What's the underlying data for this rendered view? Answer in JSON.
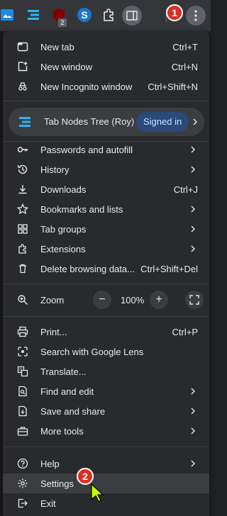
{
  "markers": {
    "one": "1",
    "two": "2"
  },
  "extension_badge": "2",
  "menu": {
    "group1": [
      {
        "icon": "new-tab-icon",
        "label": "New tab",
        "shortcut": "Ctrl+T"
      },
      {
        "icon": "new-window-icon",
        "label": "New window",
        "shortcut": "Ctrl+N"
      },
      {
        "icon": "incognito-icon",
        "label": "New Incognito window",
        "shortcut": "Ctrl+Shift+N"
      }
    ],
    "profile": {
      "label": "Tab Nodes Tree (Roy)",
      "status": "Signed in"
    },
    "group2": [
      {
        "icon": "key-icon",
        "label": "Passwords and autofill",
        "shortcut": ""
      },
      {
        "icon": "history-icon",
        "label": "History",
        "shortcut": ""
      },
      {
        "icon": "download-icon",
        "label": "Downloads",
        "shortcut": "Ctrl+J"
      },
      {
        "icon": "star-icon",
        "label": "Bookmarks and lists",
        "shortcut": ""
      },
      {
        "icon": "tab-groups-icon",
        "label": "Tab groups",
        "shortcut": ""
      },
      {
        "icon": "puzzle-icon",
        "label": "Extensions",
        "shortcut": ""
      },
      {
        "icon": "trash-icon",
        "label": "Delete browsing data...",
        "shortcut": "Ctrl+Shift+Del"
      }
    ],
    "zoom": {
      "label": "Zoom",
      "minus": "−",
      "value": "100%",
      "plus": "+"
    },
    "group3": [
      {
        "icon": "print-icon",
        "label": "Print...",
        "shortcut": "Ctrl+P"
      },
      {
        "icon": "lens-icon",
        "label": "Search with Google Lens",
        "shortcut": ""
      },
      {
        "icon": "translate-icon",
        "label": "Translate...",
        "shortcut": ""
      },
      {
        "icon": "find-icon",
        "label": "Find and edit",
        "shortcut": ""
      },
      {
        "icon": "save-share-icon",
        "label": "Save and share",
        "shortcut": ""
      },
      {
        "icon": "toolbox-icon",
        "label": "More tools",
        "shortcut": ""
      }
    ],
    "group4": [
      {
        "icon": "help-icon",
        "label": "Help",
        "shortcut": ""
      },
      {
        "icon": "gear-icon",
        "label": "Settings",
        "shortcut": ""
      },
      {
        "icon": "exit-icon",
        "label": "Exit",
        "shortcut": ""
      }
    ]
  }
}
